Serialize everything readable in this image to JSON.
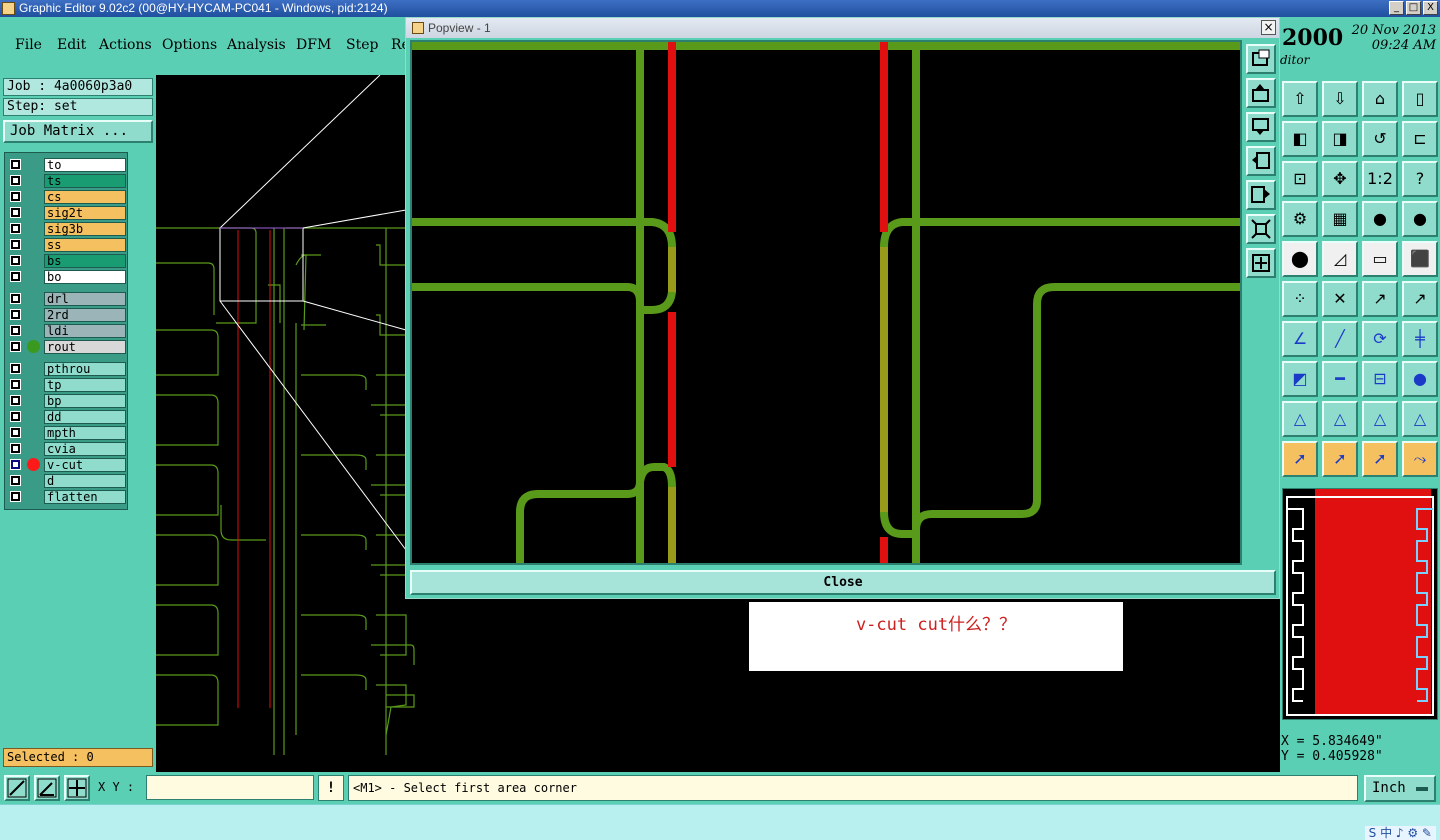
{
  "window": {
    "title": "Graphic Editor 9.02c2 (00@HY-HYCAM-PC041 - Windows, pid:2124)",
    "controls": [
      "_",
      "□",
      "X"
    ]
  },
  "menu": [
    "File",
    "Edit",
    "Actions",
    "Options",
    "Analysis",
    "DFM",
    "Step",
    "Re"
  ],
  "header_right": {
    "year": "2000",
    "date": "20 Nov 2013",
    "time": "09:24 AM",
    "editor_label": "ditor"
  },
  "job": {
    "job_label": "Job : 4a0060p3a0",
    "step_label": "Step: set",
    "matrix_button": "Job Matrix ..."
  },
  "layers": [
    {
      "name": "to",
      "color": "#ffffff",
      "dot": ""
    },
    {
      "name": "ts",
      "color": "#1a9c72",
      "dot": ""
    },
    {
      "name": "cs",
      "color": "#f5c060",
      "dot": ""
    },
    {
      "name": "sig2t",
      "color": "#f5c060",
      "dot": ""
    },
    {
      "name": "sig3b",
      "color": "#f5c060",
      "dot": ""
    },
    {
      "name": "ss",
      "color": "#f5c060",
      "dot": ""
    },
    {
      "name": "bs",
      "color": "#1a9c72",
      "dot": ""
    },
    {
      "name": "bo",
      "color": "#ffffff",
      "dot": ""
    },
    {
      "name": "drl",
      "color": "#9ab4b8",
      "dot": ""
    },
    {
      "name": "2rd",
      "color": "#9ab4b8",
      "dot": ""
    },
    {
      "name": "ldi",
      "color": "#9ab4b8",
      "dot": ""
    },
    {
      "name": "rout",
      "color": "#d8d8d8",
      "dot": "#3a9a20"
    },
    {
      "name": "pthrou",
      "color": "#8fdccd",
      "dot": ""
    },
    {
      "name": "tp",
      "color": "#8fdccd",
      "dot": ""
    },
    {
      "name": "bp",
      "color": "#8fdccd",
      "dot": ""
    },
    {
      "name": "dd",
      "color": "#8fdccd",
      "dot": ""
    },
    {
      "name": "mpth",
      "color": "#8fdccd",
      "dot": ""
    },
    {
      "name": "cvia",
      "color": "#8fdccd",
      "dot": ""
    },
    {
      "name": "v-cut",
      "color": "#8fdccd",
      "dot": "#ff1a1a"
    },
    {
      "name": "d",
      "color": "#8fdccd",
      "dot": ""
    },
    {
      "name": "flatten",
      "color": "#8fdccd",
      "dot": ""
    }
  ],
  "selected_label": "Selected : 0",
  "command": {
    "xy_label": "X Y :",
    "xy_value": "",
    "excl": "!",
    "prompt": "<M1> - Select first area corner",
    "unit": "Inch"
  },
  "coords": {
    "x": "X = 5.834649\"",
    "y": "Y = 0.405928\""
  },
  "popview": {
    "title": "Popview - 1",
    "close_label": "Close"
  },
  "note": "v-cut cut什么？？",
  "tray": "S 中 ♪ ⚙ ✎",
  "colors": {
    "panel": "#5bcfb4",
    "trace": "#5a9a1a",
    "vcut": "#e01010",
    "highlight": "#f5c060"
  }
}
